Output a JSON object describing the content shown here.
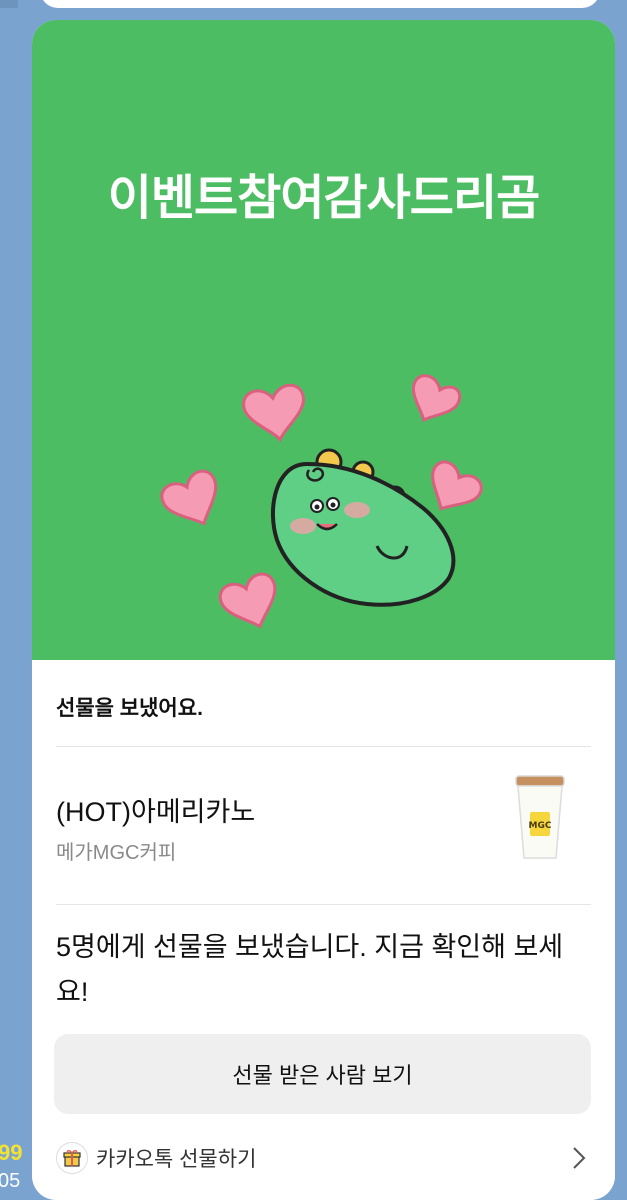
{
  "side": {
    "unread_count": "99",
    "time": "05"
  },
  "card": {
    "hero_title": "이벤트참여감사드리곰",
    "sent_label": "선물을 보냈어요.",
    "product": {
      "name": "(HOT)아메리카노",
      "brand": "메가MGC커피"
    },
    "message": "5명에게 선물을 보냈습니다. 지금 확인해 보세요!",
    "button_label": "선물 받은 사람 보기",
    "footer_label": "카카오톡 선물하기"
  },
  "icons": {
    "mascot": "green-dinosaur-with-hearts",
    "product_thumbnail": "coffee-cup-icon",
    "footer_logo": "gift-box-icon",
    "chevron": "chevron-right-icon"
  },
  "colors": {
    "background": "#7aa3cf",
    "hero": "#4cbd63",
    "button": "#efefef",
    "unread_badge": "#f2e233"
  }
}
